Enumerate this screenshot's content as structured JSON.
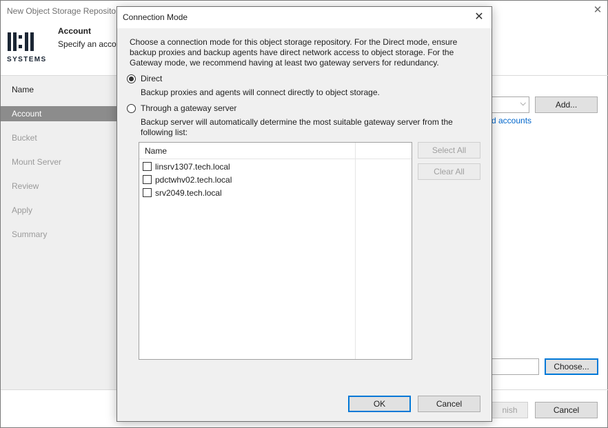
{
  "wizard": {
    "title": "New Object Storage Repository",
    "logo_text": "SYSTEMS",
    "header_title": "Account",
    "header_subtitle": "Specify an account",
    "steps": [
      {
        "label": "Name",
        "state": "done"
      },
      {
        "label": "Account",
        "state": "active"
      },
      {
        "label": "Bucket",
        "state": "pending"
      },
      {
        "label": "Mount Server",
        "state": "pending"
      },
      {
        "label": "Review",
        "state": "pending"
      },
      {
        "label": "Apply",
        "state": "pending"
      },
      {
        "label": "Summary",
        "state": "pending"
      }
    ],
    "add_button": "Add...",
    "accounts_link": "d accounts",
    "choose_button": "Choose...",
    "finish_button": "nish",
    "cancel_button": "Cancel"
  },
  "dialog": {
    "title": "Connection Mode",
    "description": "Choose a connection mode for this object storage repository. For the Direct mode, ensure backup proxies and backup agents have direct network access to object storage. For the Gateway mode, we recommend having at least two gateway servers for redundancy.",
    "options": [
      {
        "label": "Direct",
        "selected": true,
        "help": "Backup proxies and agents will connect directly to object storage."
      },
      {
        "label": "Through a gateway server",
        "selected": false,
        "help": "Backup server will automatically determine the most suitable gateway server from the following list:"
      }
    ],
    "list": {
      "column_name": "Name",
      "rows": [
        {
          "name": "linsrv1307.tech.local",
          "checked": false
        },
        {
          "name": "pdctwhv02.tech.local",
          "checked": false
        },
        {
          "name": "srv2049.tech.local",
          "checked": false
        }
      ]
    },
    "select_all_button": "Select All",
    "clear_all_button": "Clear All",
    "ok_button": "OK",
    "cancel_button": "Cancel"
  }
}
